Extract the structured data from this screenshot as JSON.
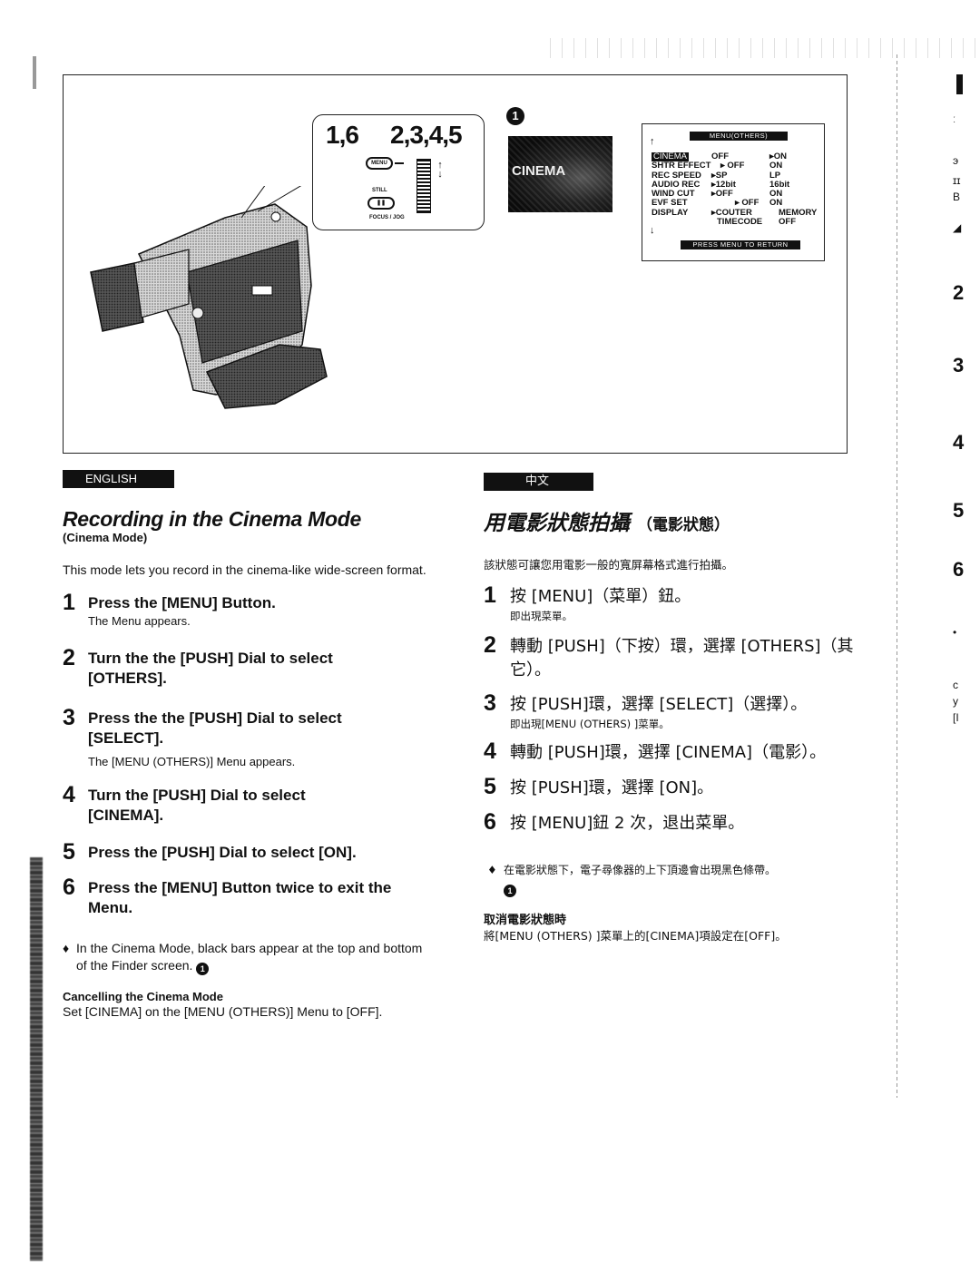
{
  "figure": {
    "callout": {
      "steps_left": "1,6",
      "steps_right": "2,3,4,5",
      "menu_button": "MENU",
      "still_label": "STILL",
      "still_button": "❚❚",
      "focus_label": "FOCUS / JOG",
      "dial_arrows": "↑ ↓"
    },
    "marker": "1",
    "finder_text": "CINEMA",
    "menu_screen": {
      "title": "MENU(OTHERS)",
      "arrow_up": "↑",
      "arrow_down": "↓",
      "rows": [
        {
          "label": "CINEMA",
          "v1": "OFF",
          "v2": "▸ON",
          "highlight": true
        },
        {
          "label": "SHTR EFFECT",
          "v1": "▸ OFF",
          "v2": "ON"
        },
        {
          "label": "REC SPEED",
          "v1": "▸SP",
          "v2": "LP"
        },
        {
          "label": "AUDIO REC",
          "v1": "▸12bit",
          "v2": "16bit"
        },
        {
          "label": "WIND CUT",
          "v1": "▸OFF",
          "v2": "ON"
        },
        {
          "label": "EVF SET",
          "v1": "▸ OFF",
          "v2": "ON"
        },
        {
          "label": "DISPLAY",
          "v1": "▸COUTER",
          "v2": "MEMORY"
        },
        {
          "label": "",
          "v1": "TIMECODE",
          "v2": "OFF"
        }
      ],
      "footer": "PRESS MENU TO RETURN"
    }
  },
  "english": {
    "tab": "ENGLISH",
    "title": "Recording in the Cinema Mode",
    "subtitle": "(Cinema Mode)",
    "intro": "This mode lets you record in the cinema-like wide-screen format.",
    "steps": [
      {
        "num": "1",
        "title": "Press the [MENU] Button.",
        "note": "The Menu appears."
      },
      {
        "num": "2",
        "title": "Turn the the [PUSH] Dial to select [OTHERS].",
        "note": ""
      },
      {
        "num": "3",
        "title": "Press the the [PUSH] Dial to select [SELECT].",
        "note": "The [MENU (OTHERS)] Menu appears."
      },
      {
        "num": "4",
        "title": "Turn the [PUSH] Dial to select [CINEMA].",
        "note": ""
      },
      {
        "num": "5",
        "title": "Press the [PUSH] Dial to select [ON].",
        "note": ""
      },
      {
        "num": "6",
        "title": "Press the [MENU] Button twice to exit the Menu.",
        "note": ""
      }
    ],
    "bullet": "In the Cinema Mode, black bars appear at the top and bottom of the Finder screen.",
    "bullet_ref": "1",
    "cancel_heading": "Cancelling the Cinema Mode",
    "cancel_text": "Set [CINEMA] on the [MENU (OTHERS)] Menu to [OFF]."
  },
  "chinese": {
    "tab": "中文",
    "title": "用電影狀態拍攝",
    "title_suffix": "（電影狀態）",
    "intro": "該狀態可讓您用電影一般的寬屏幕格式進行拍攝。",
    "steps": [
      {
        "num": "1",
        "title": "按 [MENU]（菜單）鈕。",
        "note": "即出現菜單。"
      },
      {
        "num": "2",
        "title": "轉動 [PUSH]（下按）環，選擇 [OTHERS]（其它）。",
        "note": ""
      },
      {
        "num": "3",
        "title": "按 [PUSH]環，選擇 [SELECT]（選擇）。",
        "note": "即出現[MENU (OTHERS) ]菜單。"
      },
      {
        "num": "4",
        "title": "轉動 [PUSH]環，選擇 [CINEMA]（電影）。",
        "note": ""
      },
      {
        "num": "5",
        "title": "按 [PUSH]環，選擇 [ON]。",
        "note": ""
      },
      {
        "num": "6",
        "title": "按 [MENU]鈕 2 次，退出菜單。",
        "note": ""
      }
    ],
    "bullet": "在電影狀態下，電子尋像器的上下頂邊會出現黑色條帶。",
    "bullet_ref": "1",
    "cancel_heading": "取消電影狀態時",
    "cancel_text": "將[MENU (OTHERS) ]菜單上的[CINEMA]項設定在[OFF]。"
  },
  "next_page_bleed": [
    "ː",
    "э",
    "ɪɪ",
    "B",
    "◢",
    "2",
    "3",
    "4",
    "5",
    "6",
    "•",
    "c",
    "y",
    "[I"
  ]
}
